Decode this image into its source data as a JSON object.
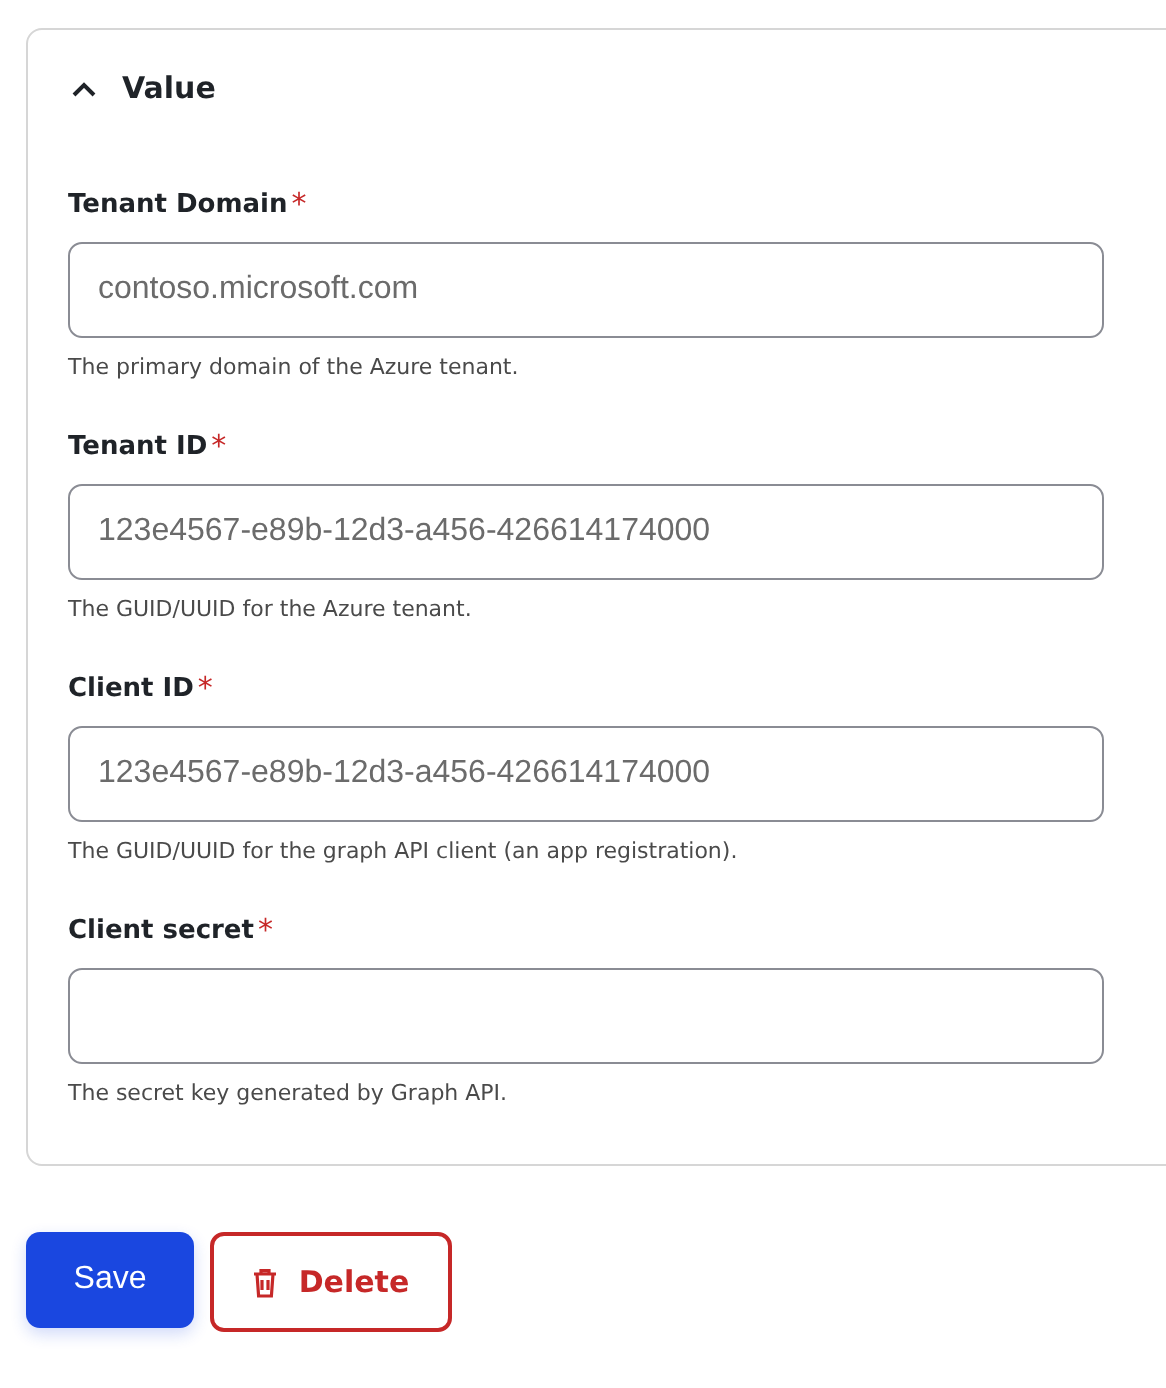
{
  "section": {
    "title": "Value",
    "expanded": true
  },
  "fields": [
    {
      "label": "Tenant Domain",
      "required_mark": "*",
      "placeholder": "contoso.microsoft.com",
      "help": "The primary domain of the Azure tenant."
    },
    {
      "label": "Tenant ID",
      "required_mark": "*",
      "placeholder": "123e4567-e89b-12d3-a456-426614174000",
      "help": "The GUID/UUID for the Azure tenant."
    },
    {
      "label": "Client ID",
      "required_mark": "*",
      "placeholder": "123e4567-e89b-12d3-a456-426614174000",
      "help": "The GUID/UUID for the graph API client (an app registration)."
    },
    {
      "label": "Client secret",
      "required_mark": "*",
      "help": "The secret key generated by Graph API."
    }
  ],
  "buttons": [
    {
      "label": "Save",
      "kind": "primary"
    },
    {
      "label": "Delete",
      "kind": "danger"
    }
  ]
}
